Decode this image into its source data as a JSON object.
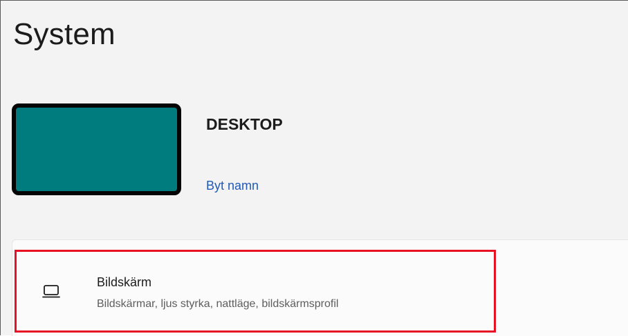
{
  "page": {
    "title": "System"
  },
  "device": {
    "name": "DESKTOP",
    "rename_label": "Byt namn",
    "thumbnail_color": "#007c7e"
  },
  "settings": {
    "items": [
      {
        "icon": "laptop-icon",
        "title": "Bildskärm",
        "description": "Bildskärmar, ljus styrka, nattläge, bildskärmsprofil",
        "highlighted": true
      }
    ]
  },
  "colors": {
    "link": "#1f5ab7",
    "highlight_border": "#e81123",
    "background": "#f3f3f3"
  }
}
